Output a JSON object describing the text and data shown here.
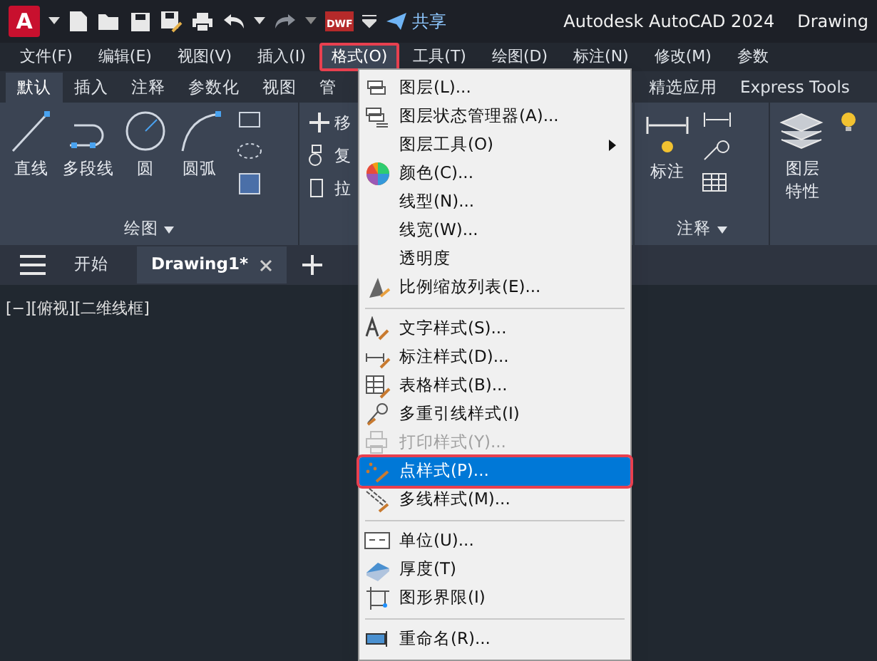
{
  "window": {
    "logo": "A",
    "title": "Autodesk AutoCAD 2024",
    "document": "Drawing",
    "share": "共享",
    "dwf": "DWF"
  },
  "menu_bar": [
    {
      "label": "文件(F)",
      "selected": false,
      "annotated": false
    },
    {
      "label": "编辑(E)",
      "selected": false,
      "annotated": false
    },
    {
      "label": "视图(V)",
      "selected": false,
      "annotated": false
    },
    {
      "label": "插入(I)",
      "selected": false,
      "annotated": false
    },
    {
      "label": "格式(O)",
      "selected": true,
      "annotated": true
    },
    {
      "label": "工具(T)",
      "selected": false,
      "annotated": false
    },
    {
      "label": "绘图(D)",
      "selected": false,
      "annotated": false
    },
    {
      "label": "标注(N)",
      "selected": false,
      "annotated": false
    },
    {
      "label": "修改(M)",
      "selected": false,
      "annotated": false
    },
    {
      "label": "参数",
      "selected": false,
      "annotated": false
    }
  ],
  "ribbon_tabs": [
    {
      "label": "默认",
      "selected": true
    },
    {
      "label": "插入",
      "selected": false
    },
    {
      "label": "注释",
      "selected": false
    },
    {
      "label": "参数化",
      "selected": false
    },
    {
      "label": "视图",
      "selected": false
    },
    {
      "label": "管",
      "selected": false
    },
    {
      "label": "精选应用",
      "selected": false
    },
    {
      "label": "Express Tools",
      "selected": false
    }
  ],
  "ribbon": {
    "draw_tools": [
      "直线",
      "多段线",
      "圆",
      "圆弧"
    ],
    "draw_panel": "绘图",
    "modify_tools": [
      "移",
      "复",
      "拉"
    ],
    "annotation_tool": "标注",
    "annotation_panel": "注释",
    "layers_tool": "图层特性"
  },
  "file_tabs": [
    {
      "label": "开始",
      "selected": false,
      "closable": false
    },
    {
      "label": "Drawing1*",
      "selected": true,
      "closable": true
    }
  ],
  "viewport_label": "[−][俯视][二维线框]",
  "format_menu": [
    {
      "kind": "item",
      "label": "图层(L)...",
      "disabled": false,
      "selected": false,
      "annotated": false,
      "submenu": false
    },
    {
      "kind": "item",
      "label": "图层状态管理器(A)...",
      "disabled": false,
      "selected": false,
      "annotated": false,
      "submenu": false
    },
    {
      "kind": "item",
      "label": "图层工具(O)",
      "disabled": false,
      "selected": false,
      "annotated": false,
      "submenu": true
    },
    {
      "kind": "item",
      "label": "颜色(C)...",
      "disabled": false,
      "selected": false,
      "annotated": false,
      "submenu": false
    },
    {
      "kind": "item",
      "label": "线型(N)...",
      "disabled": false,
      "selected": false,
      "annotated": false,
      "submenu": false
    },
    {
      "kind": "item",
      "label": "线宽(W)...",
      "disabled": false,
      "selected": false,
      "annotated": false,
      "submenu": false
    },
    {
      "kind": "item",
      "label": "透明度",
      "disabled": false,
      "selected": false,
      "annotated": false,
      "submenu": false
    },
    {
      "kind": "item",
      "label": "比例缩放列表(E)...",
      "disabled": false,
      "selected": false,
      "annotated": false,
      "submenu": false
    },
    {
      "kind": "separator"
    },
    {
      "kind": "item",
      "label": "文字样式(S)...",
      "disabled": false,
      "selected": false,
      "annotated": false,
      "submenu": false
    },
    {
      "kind": "item",
      "label": "标注样式(D)...",
      "disabled": false,
      "selected": false,
      "annotated": false,
      "submenu": false
    },
    {
      "kind": "item",
      "label": "表格样式(B)...",
      "disabled": false,
      "selected": false,
      "annotated": false,
      "submenu": false
    },
    {
      "kind": "item",
      "label": "多重引线样式(I)",
      "disabled": false,
      "selected": false,
      "annotated": false,
      "submenu": false
    },
    {
      "kind": "item",
      "label": "打印样式(Y)...",
      "disabled": true,
      "selected": false,
      "annotated": false,
      "submenu": false
    },
    {
      "kind": "item",
      "label": "点样式(P)...",
      "disabled": false,
      "selected": true,
      "annotated": true,
      "submenu": false
    },
    {
      "kind": "item",
      "label": "多线样式(M)...",
      "disabled": false,
      "selected": false,
      "annotated": false,
      "submenu": false
    },
    {
      "kind": "separator"
    },
    {
      "kind": "item",
      "label": "单位(U)...",
      "disabled": false,
      "selected": false,
      "annotated": false,
      "submenu": false
    },
    {
      "kind": "item",
      "label": "厚度(T)",
      "disabled": false,
      "selected": false,
      "annotated": false,
      "submenu": false
    },
    {
      "kind": "item",
      "label": "图形界限(I)",
      "disabled": false,
      "selected": false,
      "annotated": false,
      "submenu": false
    },
    {
      "kind": "separator"
    },
    {
      "kind": "item",
      "label": "重命名(R)...",
      "disabled": false,
      "selected": false,
      "annotated": false,
      "submenu": false
    }
  ]
}
